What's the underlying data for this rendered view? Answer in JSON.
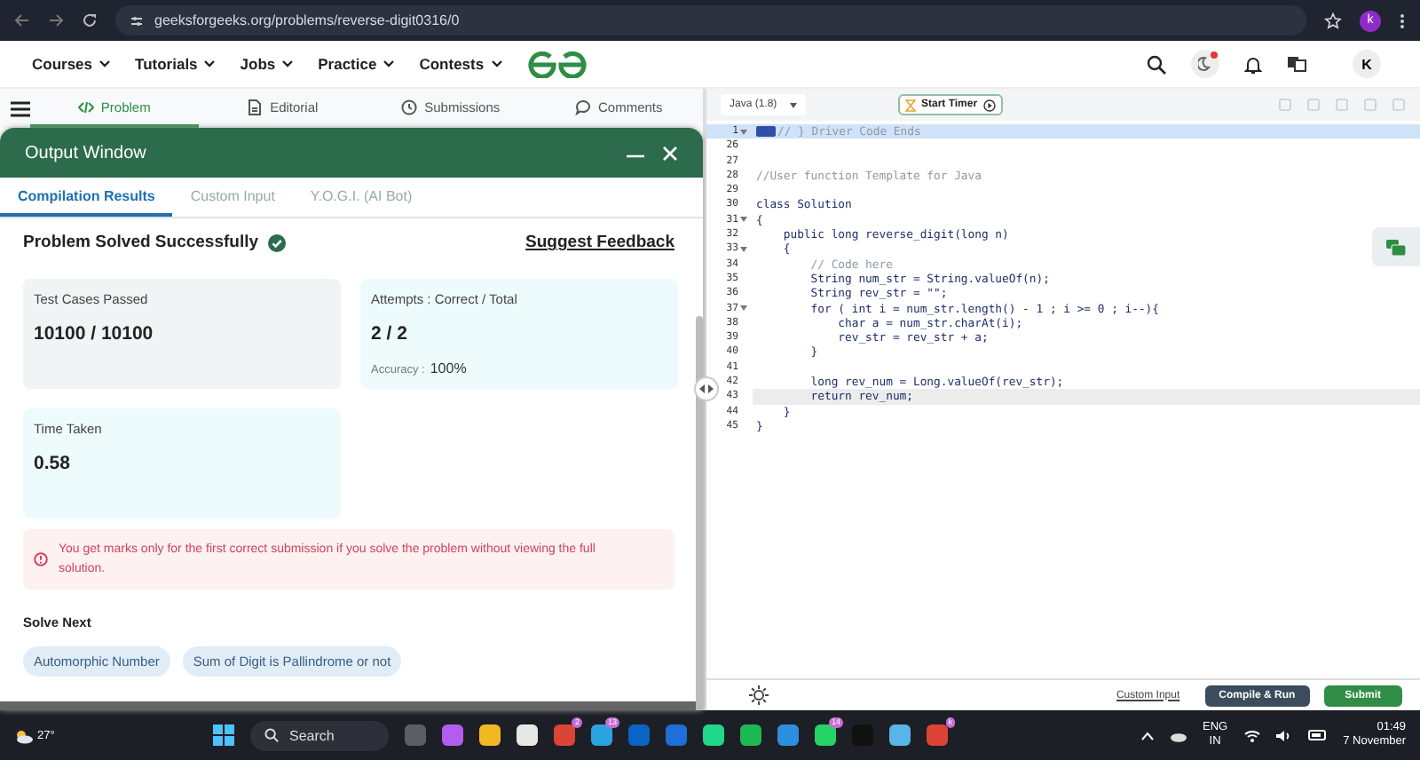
{
  "browser": {
    "url": "geeksforgeeks.org/problems/reverse-digit0316/0",
    "profile_initial": "k"
  },
  "site_nav": {
    "menus": [
      "Courses",
      "Tutorials",
      "Jobs",
      "Practice",
      "Contests"
    ],
    "avatar": "K"
  },
  "problem_tabs": [
    {
      "label": "Problem",
      "selected": true
    },
    {
      "label": "Editorial",
      "selected": false
    },
    {
      "label": "Submissions",
      "selected": false
    },
    {
      "label": "Comments",
      "selected": false
    }
  ],
  "output_window": {
    "title": "Output Window",
    "tabs": [
      {
        "label": "Compilation Results",
        "selected": true
      },
      {
        "label": "Custom Input",
        "selected": false
      },
      {
        "label": "Y.O.G.I. (AI Bot)",
        "selected": false
      }
    ],
    "status": "Problem Solved Successfully",
    "feedback_link": "Suggest Feedback",
    "cards": [
      {
        "label": "Test Cases Passed",
        "value": "10100 / 10100",
        "color": "#f1f4f4"
      },
      {
        "label": "Attempts : Correct / Total",
        "value": "2 / 2",
        "extra_label": "Accuracy :",
        "extra_value": "100%",
        "color": "#eefbfd"
      },
      {
        "label": "Time Taken",
        "value": "0.58",
        "color": "#eefbfd"
      }
    ],
    "notice": "You get marks only for the first correct submission if you solve the problem without viewing the full solution.",
    "solve_next_title": "Solve Next",
    "suggestions": [
      "Automorphic Number",
      "Sum of Digit is Pallindrome or not"
    ]
  },
  "editor": {
    "language": "Java (1.8)",
    "timer_button": "Start Timer",
    "lines": [
      {
        "number": "1",
        "foldable": true,
        "folded": true,
        "highlighted": true,
        "current": false,
        "kind": "comment",
        "text": "// } Driver Code Ends"
      },
      {
        "number": "26",
        "foldable": false,
        "folded": false,
        "highlighted": false,
        "current": false,
        "kind": "blank"
      },
      {
        "number": "27",
        "foldable": false,
        "folded": false,
        "highlighted": false,
        "current": false,
        "kind": "blank"
      },
      {
        "number": "28",
        "foldable": false,
        "folded": false,
        "highlighted": false,
        "current": false,
        "kind": "comment",
        "text": "//User function Template for Java"
      },
      {
        "number": "29",
        "foldable": false,
        "folded": false,
        "highlighted": false,
        "current": false,
        "kind": "blank"
      },
      {
        "number": "30",
        "foldable": false,
        "folded": false,
        "highlighted": false,
        "current": false,
        "kind": "code",
        "text": "class Solution"
      },
      {
        "number": "31",
        "foldable": true,
        "folded": false,
        "highlighted": false,
        "current": false,
        "kind": "code",
        "text": "{"
      },
      {
        "number": "32",
        "foldable": false,
        "folded": false,
        "highlighted": false,
        "current": false,
        "kind": "code",
        "text": "    public long reverse_digit(long n)"
      },
      {
        "number": "33",
        "foldable": true,
        "folded": false,
        "highlighted": false,
        "current": false,
        "kind": "code",
        "text": "    {"
      },
      {
        "number": "34",
        "foldable": false,
        "folded": false,
        "highlighted": false,
        "current": false,
        "kind": "comment",
        "text": "        // Code here"
      },
      {
        "number": "35",
        "foldable": false,
        "folded": false,
        "highlighted": false,
        "current": false,
        "kind": "code",
        "text": "        String num_str = String.valueOf(n);"
      },
      {
        "number": "36",
        "foldable": false,
        "folded": false,
        "highlighted": false,
        "current": false,
        "kind": "code",
        "text": "        String rev_str = \"\";"
      },
      {
        "number": "37",
        "foldable": true,
        "folded": false,
        "highlighted": false,
        "current": false,
        "kind": "code",
        "text": "        for ( int i = num_str.length() - 1 ; i >= 0 ; i--){"
      },
      {
        "number": "38",
        "foldable": false,
        "folded": false,
        "highlighted": false,
        "current": false,
        "kind": "code",
        "text": "            char a = num_str.charAt(i);"
      },
      {
        "number": "39",
        "foldable": false,
        "folded": false,
        "highlighted": false,
        "current": false,
        "kind": "code",
        "text": "            rev_str = rev_str + a;"
      },
      {
        "number": "40",
        "foldable": false,
        "folded": false,
        "highlighted": false,
        "current": false,
        "kind": "code",
        "text": "        }"
      },
      {
        "number": "41",
        "foldable": false,
        "folded": false,
        "highlighted": false,
        "current": false,
        "kind": "blank"
      },
      {
        "number": "42",
        "foldable": false,
        "folded": false,
        "highlighted": false,
        "current": false,
        "kind": "code",
        "text": "        long rev_num = Long.valueOf(rev_str);"
      },
      {
        "number": "43",
        "foldable": false,
        "folded": false,
        "highlighted": false,
        "current": true,
        "kind": "code",
        "text": "        return rev_num;"
      },
      {
        "number": "44",
        "foldable": false,
        "folded": false,
        "highlighted": false,
        "current": false,
        "kind": "code",
        "text": "    }"
      },
      {
        "number": "45",
        "foldable": false,
        "folded": false,
        "highlighted": false,
        "current": false,
        "kind": "code",
        "text": "}"
      }
    ],
    "custom_input": "Custom Input",
    "compile_button": "Compile & Run",
    "submit_button": "Submit"
  },
  "taskbar": {
    "weather": "27°",
    "search_placeholder": "Search",
    "apps": [
      {
        "color": "#5b5f66"
      },
      {
        "color": "#b45cf0"
      },
      {
        "color": "#f2b824"
      },
      {
        "color": "#e8e8e8"
      },
      {
        "color": "#db4437",
        "badge": "2"
      },
      {
        "color": "#2aa3e0",
        "badge": "13"
      },
      {
        "color": "#0a64c8"
      },
      {
        "color": "#1e6fd9"
      },
      {
        "color": "#21d789"
      },
      {
        "color": "#1db954"
      },
      {
        "color": "#2b8fe0"
      },
      {
        "color": "#25d366",
        "badge": "14"
      },
      {
        "color": "#111111"
      },
      {
        "color": "#59b4e8"
      },
      {
        "color": "#db4437",
        "badge": "k"
      }
    ],
    "language": "ENG",
    "region": "IN",
    "time": "01:49",
    "date": "7 November"
  }
}
